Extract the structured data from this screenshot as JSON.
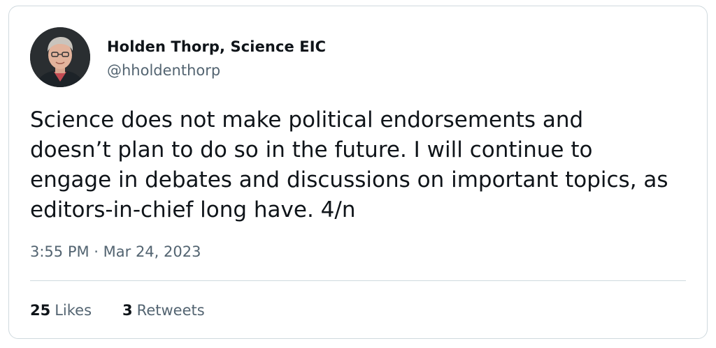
{
  "tweet": {
    "author": {
      "name": "Holden Thorp, Science EIC",
      "handle": "@hholdenthorp"
    },
    "text": "Science does not make political endorsements and\ndoesn’t plan to do so in the future. I will continue to\nengage in debates and discussions on important topics, as\neditors-in-chief long have. 4/n",
    "timestamp": "3:55 PM · Mar 24, 2023",
    "stats": {
      "likes_count": "25",
      "likes_label": "Likes",
      "retweets_count": "3",
      "retweets_label": "Retweets"
    }
  },
  "colors": {
    "text_primary": "#0f1419",
    "text_secondary": "#536471",
    "border": "#cfd9de"
  }
}
